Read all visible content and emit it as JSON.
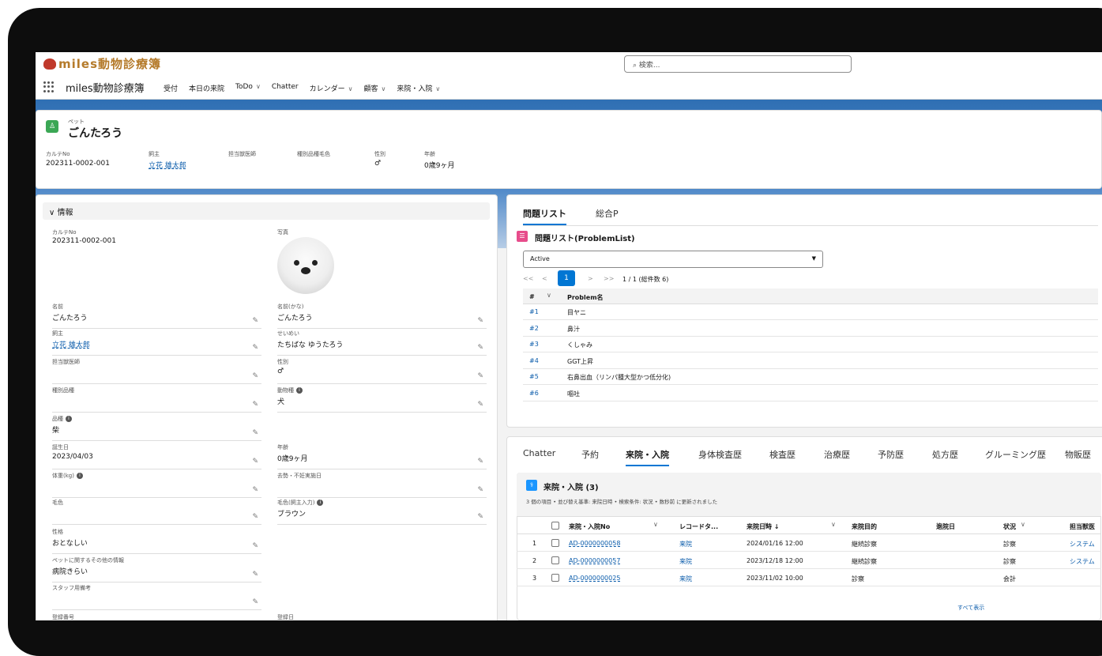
{
  "app": {
    "logo": "miles動物診療簿",
    "name": "miles動物診療簿",
    "search_placeholder": "検索..."
  },
  "nav": [
    "受付",
    "本日の来院",
    "ToDo",
    "Chatter",
    "カレンダー",
    "顧客",
    "来院・入院"
  ],
  "nav_dropdown": [
    false,
    false,
    true,
    false,
    true,
    true,
    true
  ],
  "record": {
    "type": "ペット",
    "name": "ごんたろう",
    "highlights": [
      {
        "label": "カルテNo",
        "value": "202311-0002-001",
        "link": false
      },
      {
        "label": "飼主",
        "value": "立花 雄太郎",
        "link": true
      },
      {
        "label": "担当獣医師",
        "value": "",
        "link": false
      },
      {
        "label": "種別品種毛色",
        "value": "",
        "link": false
      },
      {
        "label": "性別",
        "value": "♂",
        "link": false
      },
      {
        "label": "年齢",
        "value": "0歳9ヶ月",
        "link": false
      }
    ]
  },
  "info": {
    "section": "情報",
    "karte_label": "カルテNo",
    "karte_value": "202311-0002-001",
    "photo_label": "写真",
    "fields_left": [
      {
        "label": "名前",
        "value": "ごんたろう",
        "link": false
      },
      {
        "label": "飼主",
        "value": "立花 雄太郎",
        "link": true
      },
      {
        "label": "担当獣医師",
        "value": "",
        "link": false
      },
      {
        "label": "種別品種",
        "value": "",
        "link": false
      },
      {
        "label": "品種",
        "value": "柴",
        "link": false,
        "info": true
      },
      {
        "label": "誕生日",
        "value": "2023/04/03",
        "link": false
      },
      {
        "label": "体重(kg)",
        "value": "",
        "link": false,
        "info": true
      },
      {
        "label": "毛色",
        "value": "",
        "link": false
      },
      {
        "label": "性格",
        "value": "おとなしい",
        "link": false
      },
      {
        "label": "ペットに関するその他の情報",
        "value": "病院きらい",
        "link": false
      },
      {
        "label": "スタッフ用備考",
        "value": "",
        "link": false
      },
      {
        "label": "登録番号",
        "value": "",
        "link": false
      }
    ],
    "fields_right": [
      {
        "label": "名前(かな)",
        "value": "ごんたろう"
      },
      {
        "label": "せいめい",
        "value": "たちばな ゆうたろう"
      },
      {
        "label": "性別",
        "value": "♂"
      },
      {
        "label": "動物種",
        "value": "犬",
        "info": true
      },
      {
        "label": "年齢",
        "value": "0歳9ヶ月"
      },
      {
        "label": "去勢・不妊実施日",
        "value": ""
      },
      {
        "label": "毛色(飼主入力)",
        "value": "ブラウン",
        "info": true
      },
      {
        "label": "登録日",
        "value": ""
      }
    ]
  },
  "problems": {
    "tabs": [
      "問題リスト",
      "総合P"
    ],
    "title": "問題リスト(ProblemList)",
    "filter": "Active",
    "page_first": "<<",
    "page_prev": "<",
    "page_num": "1",
    "page_next": ">",
    "page_last": ">>",
    "page_info": "1 / 1 (総件数 6)",
    "col_num": "#",
    "col_name": "Problem名",
    "rows": [
      {
        "num": "#1",
        "name": "目ヤニ"
      },
      {
        "num": "#2",
        "name": "鼻汁"
      },
      {
        "num": "#3",
        "name": "くしゃみ"
      },
      {
        "num": "#4",
        "name": "GGT上昇"
      },
      {
        "num": "#5",
        "name": "右鼻出血（リンパ腫大型かつ低分化)"
      },
      {
        "num": "#6",
        "name": "嘔吐"
      }
    ]
  },
  "visits": {
    "tabs": [
      "Chatter",
      "予約",
      "来院・入院",
      "身体検査歴",
      "検査歴",
      "治療歴",
      "予防歴",
      "処方歴",
      "グルーミング歴",
      "物販歴"
    ],
    "title": "来院・入院 (3)",
    "subtitle": "3 個の項目 • 並び替え基準: 来院日時 • 検索条件: 状況 • 数秒前 に更新されました",
    "columns": [
      "来院・入院No",
      "レコードタ...",
      "来院日時 ↓",
      "来院目的",
      "退院日",
      "状況",
      "担当獣医"
    ],
    "rows": [
      {
        "n": "1",
        "no": "AD-0000000058",
        "type": "来院",
        "date": "2024/01/16 12:00",
        "purpose": "継続診察",
        "discharge": "",
        "status": "診察",
        "vet": "システム"
      },
      {
        "n": "2",
        "no": "AD-0000000057",
        "type": "来院",
        "date": "2023/12/18 12:00",
        "purpose": "継続診察",
        "discharge": "",
        "status": "診察",
        "vet": "システム"
      },
      {
        "n": "3",
        "no": "AD-0000000025",
        "type": "来院",
        "date": "2023/11/02 10:00",
        "purpose": "診察",
        "discharge": "",
        "status": "会計",
        "vet": ""
      }
    ],
    "view_all": "すべて表示"
  },
  "colors": {
    "accent": "#0176d3",
    "pet_icon": "#3ba755",
    "problem_icon": "#e74c8b",
    "banner": "#2f6fb3"
  }
}
